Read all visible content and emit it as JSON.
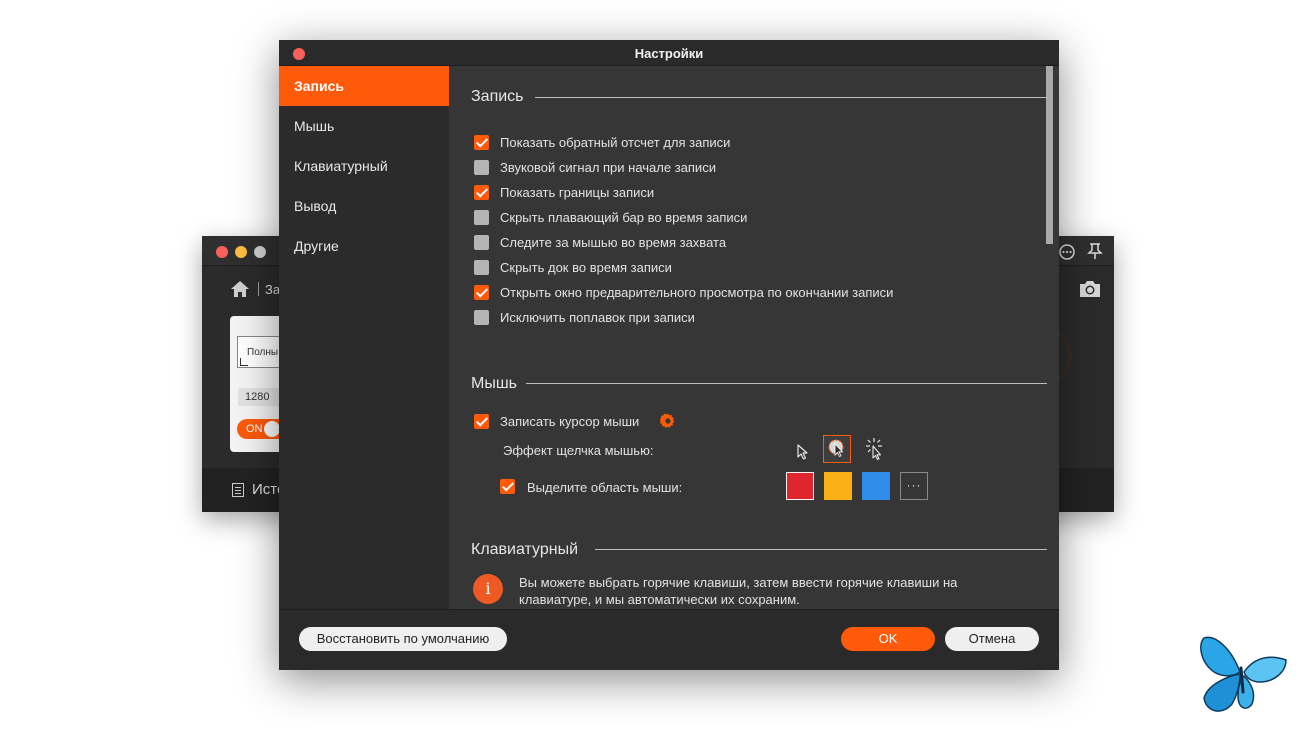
{
  "background_window": {
    "breadcrumb": "За",
    "panel_label": "Полны",
    "width_value": "1280",
    "toggle_label": "ON",
    "footer_label": "Исто"
  },
  "dialog": {
    "title": "Настройки",
    "sidebar": {
      "items": [
        {
          "label": "Запись",
          "active": true
        },
        {
          "label": "Мышь",
          "active": false
        },
        {
          "label": "Клавиатурный",
          "active": false
        },
        {
          "label": "Вывод",
          "active": false
        },
        {
          "label": "Другие",
          "active": false
        }
      ]
    },
    "recording": {
      "title": "Запись",
      "options": [
        {
          "label": "Показать обратный отсчет для записи",
          "checked": true
        },
        {
          "label": "Звуковой сигнал при начале записи",
          "checked": false
        },
        {
          "label": "Показать границы записи",
          "checked": true
        },
        {
          "label": "Скрыть плавающий бар во время записи",
          "checked": false
        },
        {
          "label": "Следите за мышью во время захвата",
          "checked": false
        },
        {
          "label": "Скрыть док во время записи",
          "checked": false
        },
        {
          "label": "Открыть окно предварительного просмотра по окончании записи",
          "checked": true
        },
        {
          "label": "Исключить поплавок при записи",
          "checked": false
        }
      ]
    },
    "mouse": {
      "title": "Мышь",
      "record_cursor": {
        "label": "Записать курсор мыши",
        "checked": true
      },
      "click_effect_label": "Эффект щелчка мышью:",
      "click_effects": [
        "plain-cursor-icon",
        "circle-click-cursor-icon",
        "sparkle-click-cursor-icon"
      ],
      "click_effect_selected": 1,
      "highlight": {
        "label": "Выделите область мыши:",
        "checked": true
      },
      "colors": [
        "#e0262d",
        "#fbb116",
        "#2f8ce8"
      ],
      "more_colors": "···"
    },
    "keyboard": {
      "title": "Клавиатурный",
      "info_icon": "i",
      "info_text": "Вы можете выбрать горячие клавиши, затем ввести горячие клавиши на клавиатуре, и мы автоматически их сохраним."
    },
    "footer": {
      "restore_label": "Восстановить по умолчанию",
      "ok_label": "OK",
      "cancel_label": "Отмена"
    },
    "accent_color": "#ff5a0a"
  }
}
